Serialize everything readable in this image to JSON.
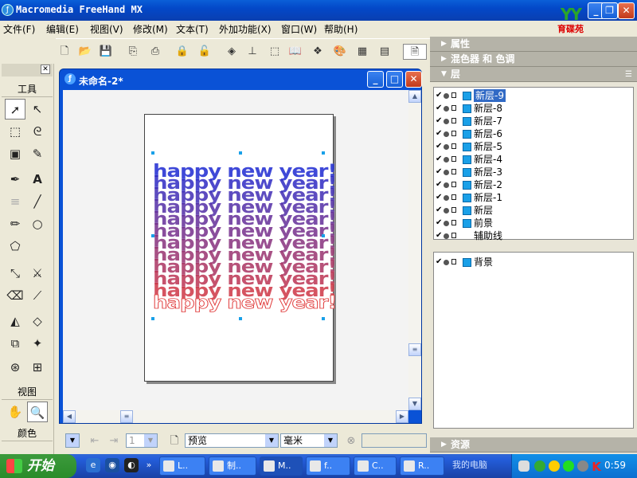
{
  "app": {
    "title": "Macromedia FreeHand MX",
    "logo_text": "育碟苑"
  },
  "menu": [
    "文件(F)",
    "编辑(E)",
    "视图(V)",
    "修改(M)",
    "文本(T)",
    "外加功能(X)",
    "窗口(W)",
    "帮助(H)"
  ],
  "tools": {
    "header": "工具",
    "view": "视图",
    "color": "颜色"
  },
  "document": {
    "title": "未命名-2*",
    "text_line": "happy new year!",
    "gradient_top": "#1e2ad2",
    "gradient_bottom": "#e03838"
  },
  "statusbar": {
    "page_value": "1",
    "preview": "预览",
    "units": "毫米"
  },
  "panels": {
    "properties": "属性",
    "mixer": "混色器 和 色调",
    "layers": "层",
    "assets": "资源"
  },
  "layers": [
    {
      "name": "新层-9",
      "selected": true
    },
    {
      "name": "新层-8"
    },
    {
      "name": "新层-7"
    },
    {
      "name": "新层-6"
    },
    {
      "name": "新层-5"
    },
    {
      "name": "新层-4"
    },
    {
      "name": "新层-3"
    },
    {
      "name": "新层-2"
    },
    {
      "name": "新层-1"
    },
    {
      "name": "新层"
    },
    {
      "name": "前景"
    },
    {
      "name": "辅助线",
      "no_swatch": true
    }
  ],
  "background_layer": "背景",
  "taskbar": {
    "start": "开始",
    "tasks": [
      "L..",
      "制..",
      "M..",
      "f..",
      "C..",
      "R..",
      "我的电脑"
    ],
    "clock": "0:59"
  }
}
